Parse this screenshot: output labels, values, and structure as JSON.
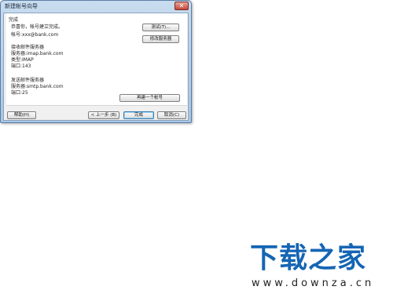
{
  "window": {
    "title": "新建帐号向导",
    "close_glyph": "✕"
  },
  "panel": {
    "header": "完成",
    "congrats": "恭喜你，帐号建立完成。",
    "account": "帐号:xxx@bank.com",
    "incoming_heading": "接收邮件服务器",
    "incoming_server": "服务器:imap.bank.com",
    "incoming_type": "类型:IMAP",
    "incoming_port": "端口:143",
    "outgoing_heading": "发送邮件服务器",
    "outgoing_server": "服务器:smtp.bank.com",
    "outgoing_port": "端口:25"
  },
  "buttons": {
    "test": "测试(T)...",
    "modify_server": "修改服务器",
    "create_another": "再建一个帐号",
    "help": "帮助(H)",
    "back": "< 上一步 (B)",
    "finish": "完成",
    "cancel": "取消(C)"
  },
  "watermark": {
    "brand": "下载之家",
    "url": "www.downza.cn"
  }
}
